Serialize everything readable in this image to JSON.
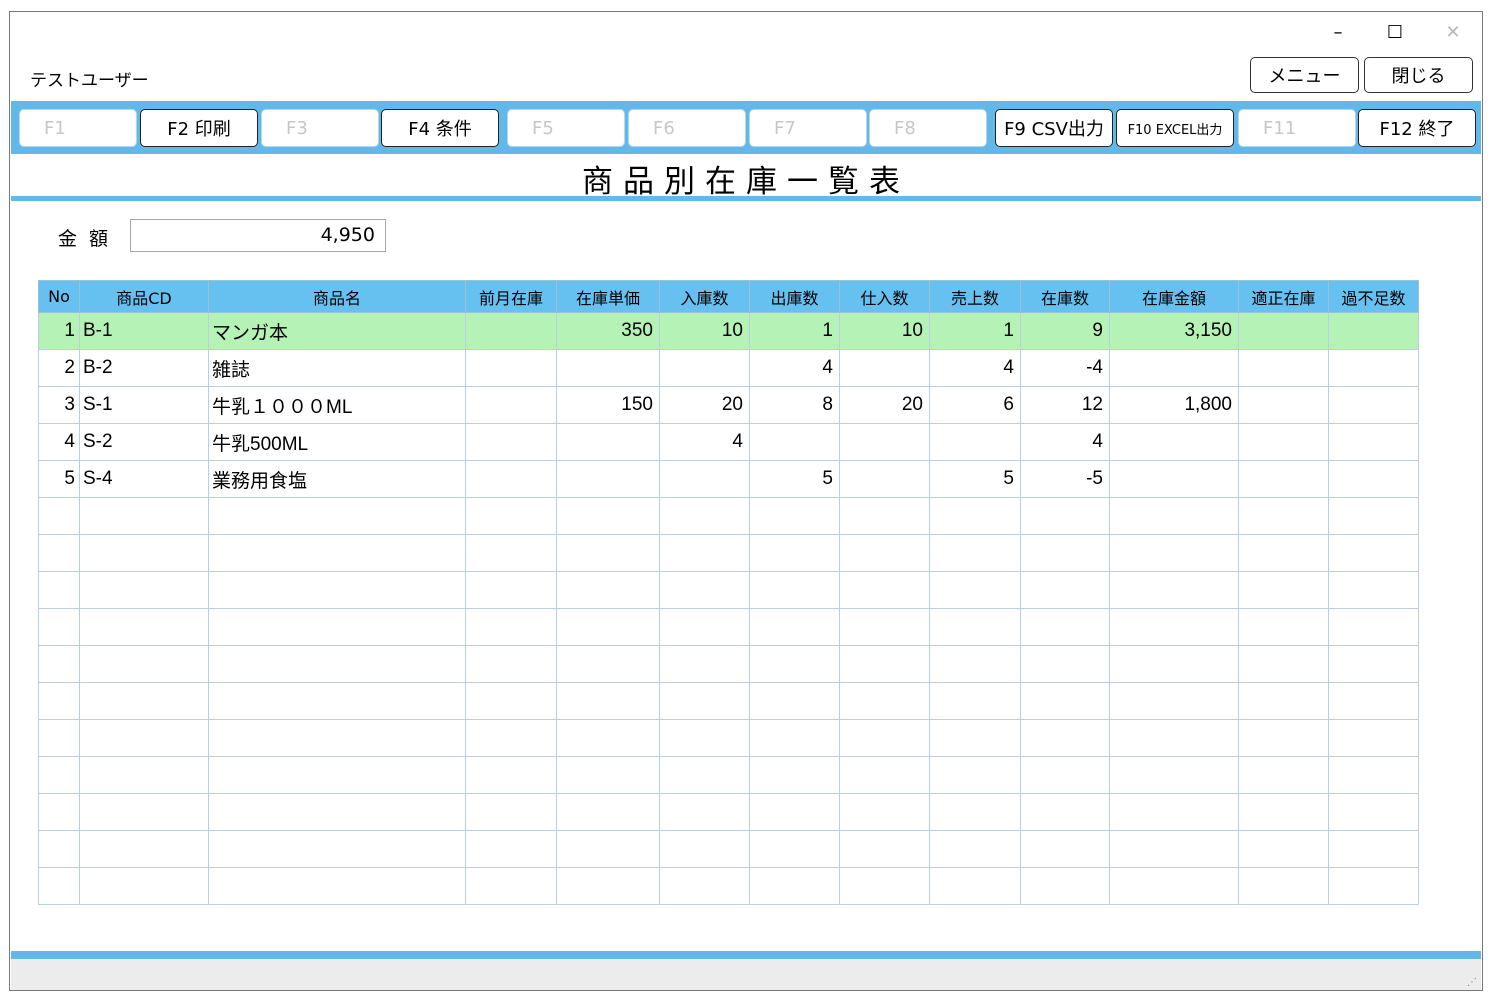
{
  "window": {
    "minimize": "–",
    "maximize": "☐",
    "close": "✕"
  },
  "header": {
    "user": "テストユーザー",
    "menu_button": "メニュー",
    "close_button": "閉じる"
  },
  "fkeys": [
    {
      "label": "F1",
      "enabled": false
    },
    {
      "label": "F2 印刷",
      "enabled": true
    },
    {
      "label": "F3",
      "enabled": false
    },
    {
      "label": "F4 条件",
      "enabled": true
    },
    {
      "label": "F5",
      "enabled": false
    },
    {
      "label": "F6",
      "enabled": false
    },
    {
      "label": "F7",
      "enabled": false
    },
    {
      "label": "F8",
      "enabled": false
    },
    {
      "label": "F9 CSV出力",
      "enabled": true
    },
    {
      "label": "F10 EXCEL出力",
      "enabled": true
    },
    {
      "label": "F11",
      "enabled": false
    },
    {
      "label": "F12 終了",
      "enabled": true
    }
  ],
  "title": "商品別在庫一覧表",
  "amount": {
    "label": "金額",
    "value": "4,950"
  },
  "table": {
    "columns": [
      "No",
      "商品CD",
      "商品名",
      "前月在庫",
      "在庫単価",
      "入庫数",
      "出庫数",
      "仕入数",
      "売上数",
      "在庫数",
      "在庫金額",
      "適正在庫",
      "過不足数"
    ],
    "rows": [
      [
        "1",
        "B-1",
        "マンガ本",
        "",
        "350",
        "10",
        "1",
        "10",
        "1",
        "9",
        "3,150",
        "",
        ""
      ],
      [
        "2",
        "B-2",
        "雑誌",
        "",
        "",
        "",
        "4",
        "",
        "4",
        "-4",
        "",
        "",
        ""
      ],
      [
        "3",
        "S-1",
        "牛乳１０００ML",
        "",
        "150",
        "20",
        "8",
        "20",
        "6",
        "12",
        "1,800",
        "",
        ""
      ],
      [
        "4",
        "S-2",
        "牛乳500ML",
        "",
        "",
        "4",
        "",
        "",
        "",
        "4",
        "",
        "",
        ""
      ],
      [
        "5",
        "S-4",
        "業務用食塩",
        "",
        "",
        "",
        "5",
        "",
        "5",
        "-5",
        "",
        "",
        ""
      ]
    ],
    "empty_rows": 11,
    "selected_row": 0
  },
  "colors": {
    "accent": "#63b8ea",
    "header_bg": "#66c0f0",
    "selected_row": "#b5f2b5"
  }
}
